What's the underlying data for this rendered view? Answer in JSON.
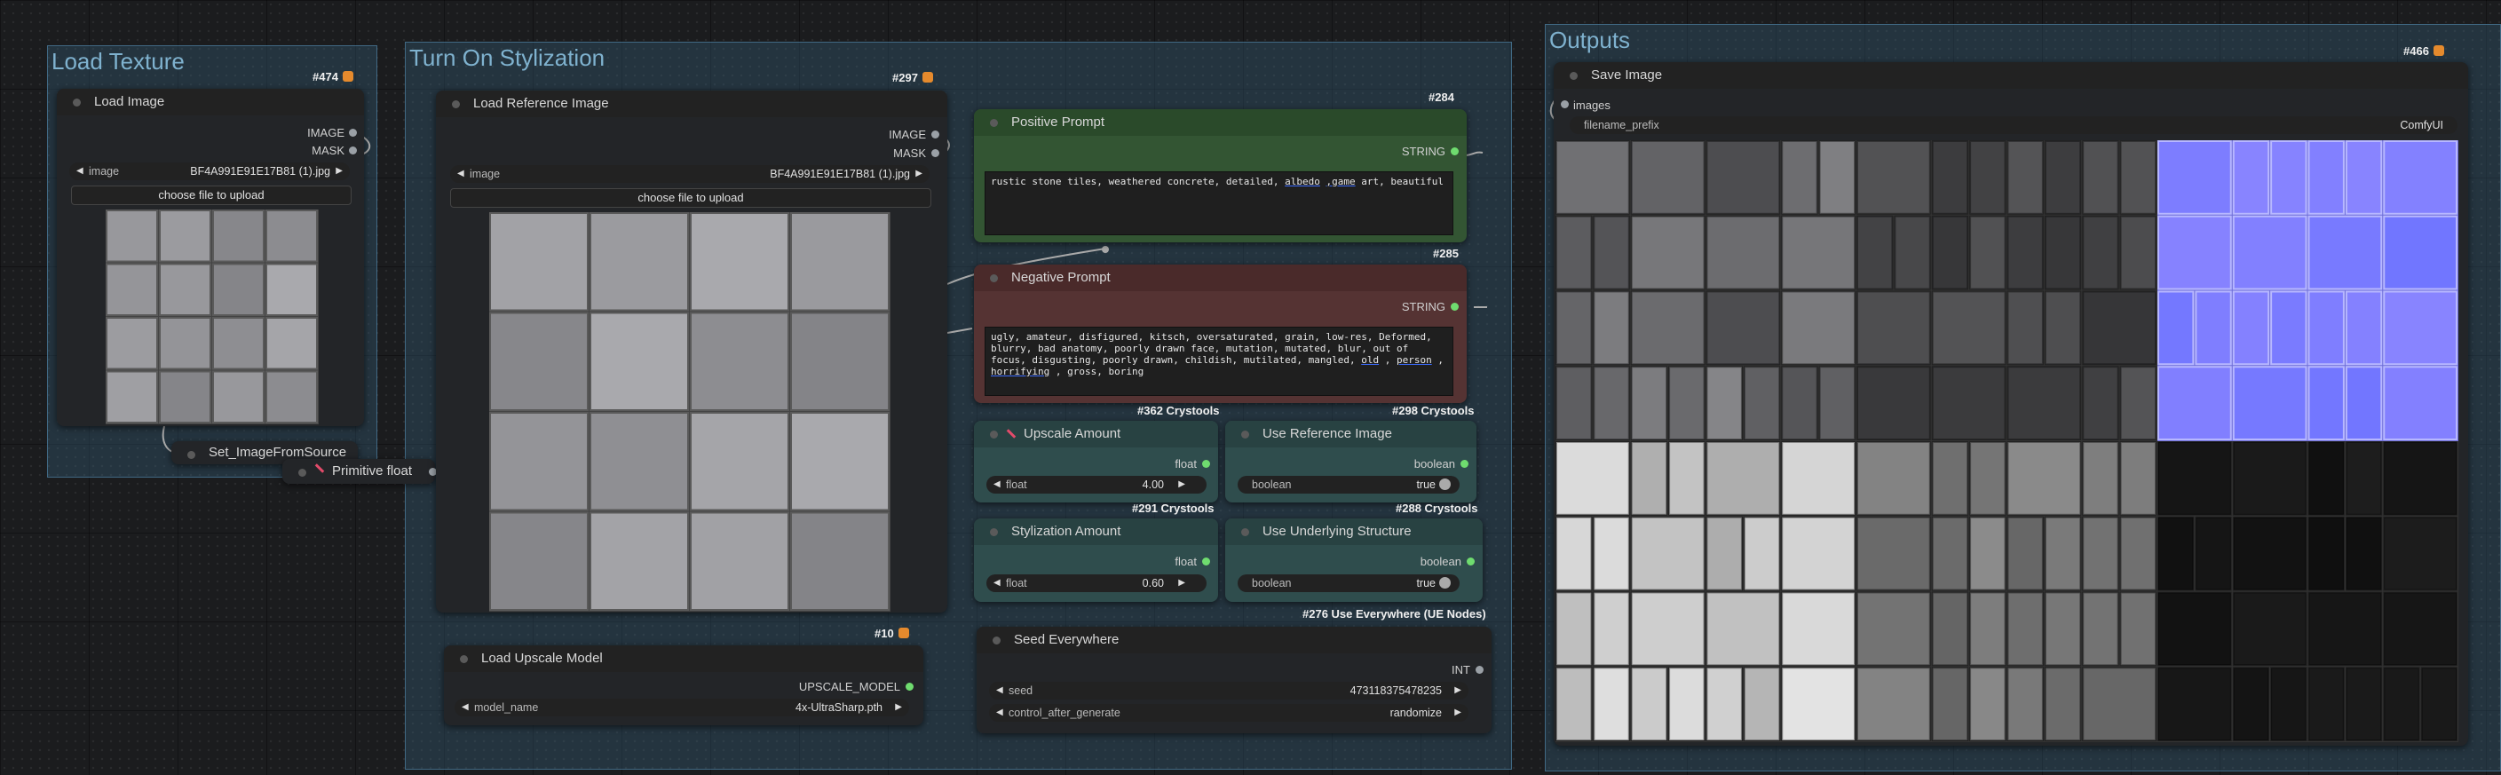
{
  "groups": {
    "load_texture": "Load Texture",
    "turn_on_stylization": "Turn On Stylization",
    "outputs": "Outputs"
  },
  "badges": {
    "load_image": "#474",
    "load_ref": "#297",
    "positive": "#284",
    "negative": "#285",
    "upscale_amount": "#362 Crystools",
    "use_reference": "#298 Crystools",
    "stylization_amount": "#291 Crystools",
    "use_underlying": "#288 Crystools",
    "upscale_model": "#10",
    "seed_everywhere": "#276 Use Everywhere (UE Nodes)",
    "save_image": "#466"
  },
  "load_image": {
    "title": "Load Image",
    "out_image": "IMAGE",
    "out_mask": "MASK",
    "image_label": "image",
    "image_value": "BF4A991E91E17B81 (1).jpg",
    "upload": "choose file to upload"
  },
  "set_image": {
    "title": "Set_ImageFromSource"
  },
  "primitive": {
    "title": "Primitive float"
  },
  "load_ref": {
    "title": "Load Reference Image",
    "out_image": "IMAGE",
    "out_mask": "MASK",
    "image_label": "image",
    "image_value": "BF4A991E91E17B81 (1).jpg",
    "upload": "choose file to upload"
  },
  "positive": {
    "title": "Positive Prompt",
    "out": "STRING",
    "text_a": "rustic stone tiles, weathered concrete, detailed, ",
    "text_u1": "albedo",
    "text_b": " ",
    "text_u2": ",game",
    "text_c": " art, beautiful"
  },
  "negative": {
    "title": "Negative Prompt",
    "out": "STRING",
    "text_a": "ugly, amateur, disfigured, kitsch, oversaturated, grain, low-res, Deformed, blurry, bad anatomy, poorly drawn face, mutation, mutated, blur, out of focus, disgusting, poorly drawn, childish, mutilated, mangled, ",
    "text_u1": "old",
    "text_b": " , ",
    "text_u2": "person",
    "text_c": " , ",
    "text_u3": "horrifying",
    "text_d": " , gross, boring"
  },
  "upscale_amount": {
    "title": "Upscale Amount",
    "out": "float",
    "label": "float",
    "value": "4.00"
  },
  "use_reference": {
    "title": "Use Reference Image",
    "out": "boolean",
    "label": "boolean",
    "value": "true"
  },
  "stylization_amount": {
    "title": "Stylization Amount",
    "out": "float",
    "label": "float",
    "value": "0.60"
  },
  "use_underlying": {
    "title": "Use Underlying Structure",
    "out": "boolean",
    "label": "boolean",
    "value": "true"
  },
  "upscale_model": {
    "title": "Load Upscale Model",
    "out": "UPSCALE_MODEL",
    "label": "model_name",
    "value": "4x-UltraSharp.pth"
  },
  "seed": {
    "title": "Seed Everywhere",
    "out": "INT",
    "seed_label": "seed",
    "seed_value": "473118375478235",
    "control_label": "control_after_generate",
    "control_value": "randomize"
  },
  "save_image": {
    "title": "Save Image",
    "in_images": "images",
    "prefix_label": "filename_prefix",
    "prefix_value": "ComfyUI"
  },
  "colors": {
    "group_blue": "#345c76",
    "positive_green": "#335533",
    "negative_red": "#553333",
    "crystools_teal": "#2f4d4d",
    "link_green": "#6fdc6f",
    "normal_map_purple": "#8080ff"
  }
}
